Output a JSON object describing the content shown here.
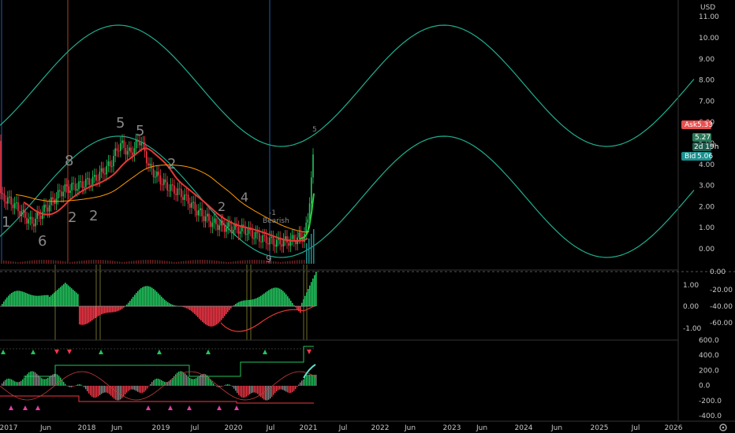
{
  "currency": "USD",
  "price_axis": [
    "11.00",
    "10.00",
    "9.00",
    "8.00",
    "7.00",
    "6.00",
    "5.00",
    "4.00",
    "3.00",
    "2.00",
    "1.00",
    "0.00"
  ],
  "osc1_axis_left": [
    "1.00",
    "0.00",
    "-1.00"
  ],
  "osc1_axis_right": [
    "0.00",
    "-20.00",
    "-40.00",
    "-60.00"
  ],
  "osc2_axis": [
    "600.0",
    "400.0",
    "200.0",
    "0.0",
    "-200.0",
    "-400.0"
  ],
  "time_axis": [
    "2017",
    "Jun",
    "2018",
    "Jun",
    "2019",
    "Jul",
    "2020",
    "Jul",
    "2021",
    "Jul",
    "2022",
    "Jun",
    "2023",
    "Jun",
    "2024",
    "Jun",
    "2025",
    "Jul",
    "2026"
  ],
  "price_tags": {
    "ask_label": "Ask",
    "ask_value": "5.33",
    "last_value": "5.27",
    "countdown": "2d 19h",
    "bid_label": "Bid",
    "bid_value": "5.06"
  },
  "annotations": {
    "seq_labels": [
      "1",
      "6",
      "8",
      "2",
      "2",
      "5",
      "5",
      "2",
      "2",
      "4",
      "1",
      "5"
    ],
    "bearish_count": "-1",
    "bearish_label": "Bearish",
    "nine": "9"
  },
  "colors": {
    "background": "#000000",
    "wave": "#1fae8e",
    "candle_red": "#f23645",
    "candle_green": "#22c55e",
    "ma_red": "#e53935",
    "ma_green": "#2ecc40",
    "ma_orange": "#ff9800",
    "ask_tag": "#e84f4f",
    "bid_tag": "#1e8f8f",
    "last_tag": "#2a7a5a",
    "vline_blue": "#1e4e8c",
    "vline_orange": "#8b3a1e",
    "vline_olive": "#6b6b2a"
  },
  "series_meta": {
    "chart": "candles",
    "icons": [
      "logo-icon",
      "settings-icon"
    ]
  }
}
